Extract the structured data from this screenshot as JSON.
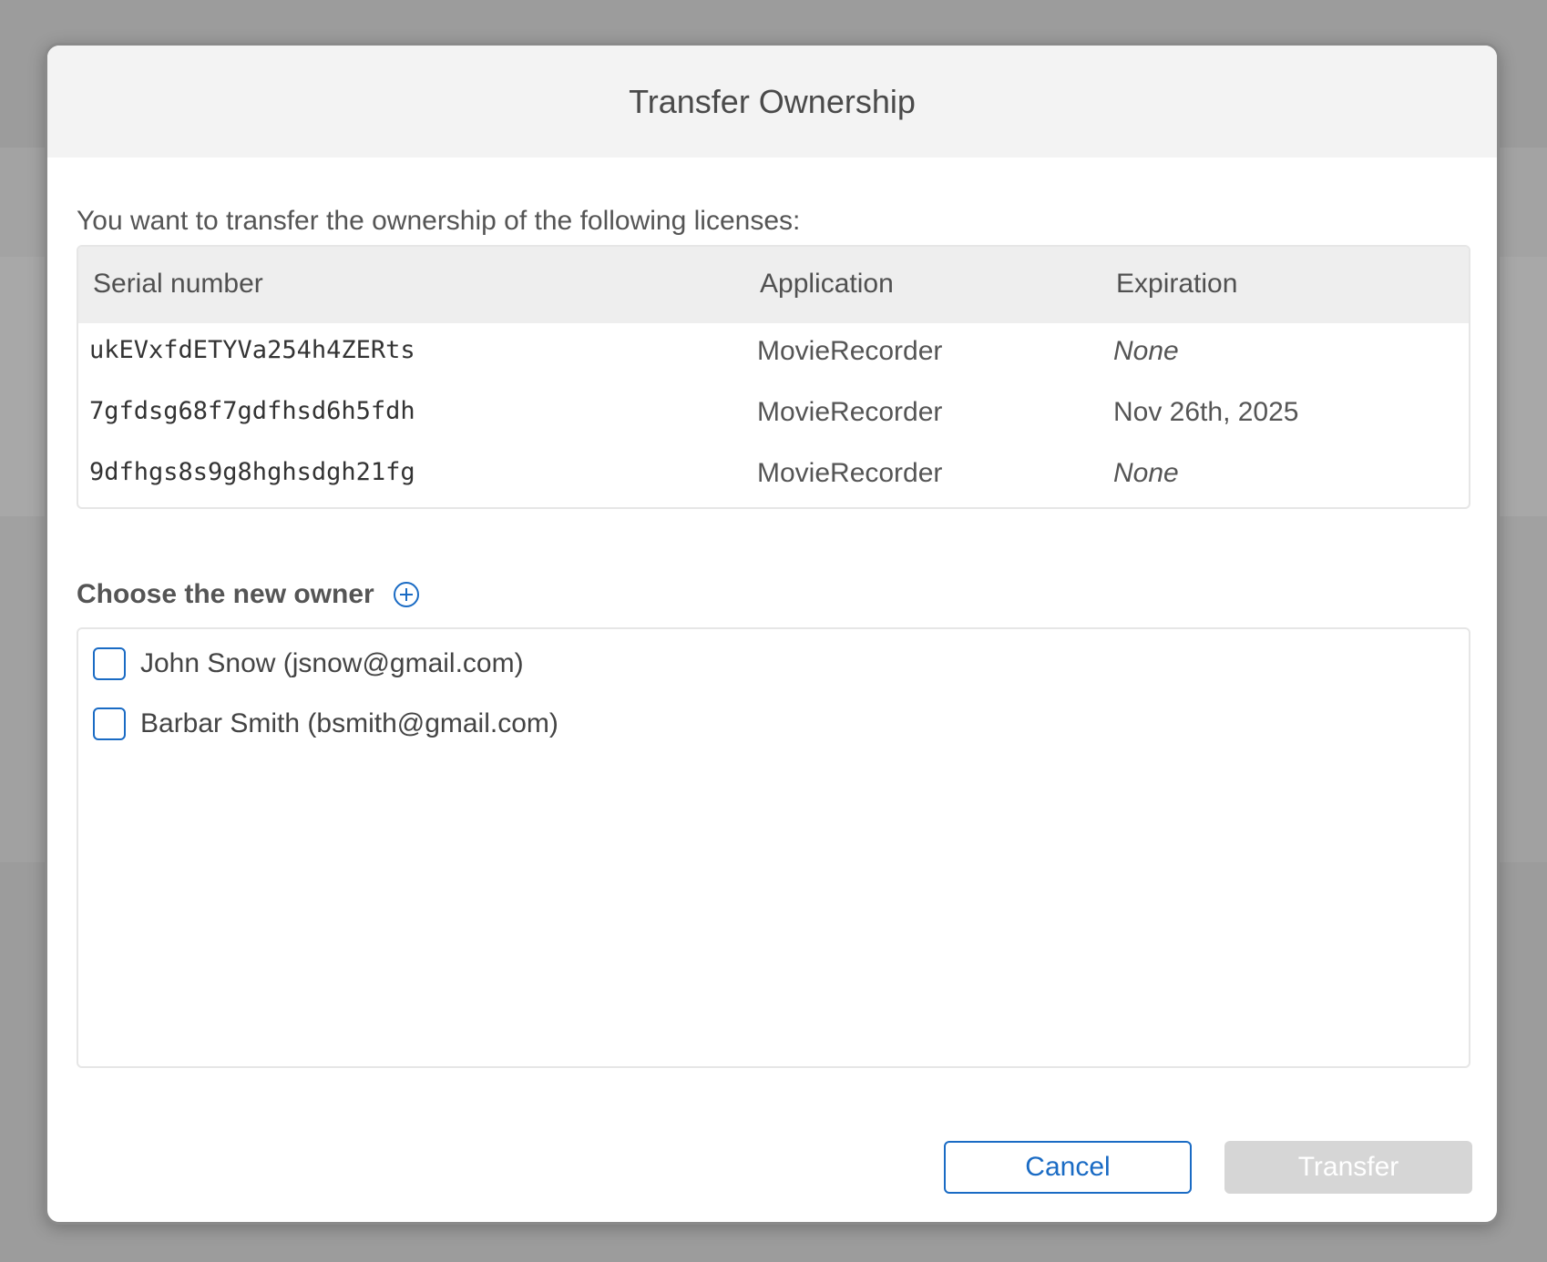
{
  "dialog": {
    "title": "Transfer Ownership",
    "intro": "You want to transfer the ownership of the following licenses:"
  },
  "table": {
    "headers": {
      "serial": "Serial number",
      "application": "Application",
      "expiration": "Expiration"
    },
    "rows": [
      {
        "serial": "ukEVxfdETYVa254h4ZERts",
        "application": "MovieRecorder",
        "expiration": "None"
      },
      {
        "serial": "7gfdsg68f7gdfhsd6h5fdh",
        "application": "MovieRecorder",
        "expiration": "Nov 26th, 2025"
      },
      {
        "serial": "9dfhgs8s9g8hghsdgh21fg",
        "application": "MovieRecorder",
        "expiration": "None"
      }
    ]
  },
  "owners": {
    "label": "Choose the new owner",
    "add_icon": "plus-circle-icon",
    "items": [
      {
        "label": "John Snow (jsnow@gmail.com)",
        "checked": false
      },
      {
        "label": "Barbar Smith (bsmith@gmail.com)",
        "checked": false
      }
    ]
  },
  "actions": {
    "cancel_label": "Cancel",
    "transfer_label": "Transfer",
    "transfer_enabled": false
  },
  "colors": {
    "accent": "#1a6bc4",
    "disabled_button": "#d6d6d6",
    "header_bg": "#f3f3f3"
  }
}
